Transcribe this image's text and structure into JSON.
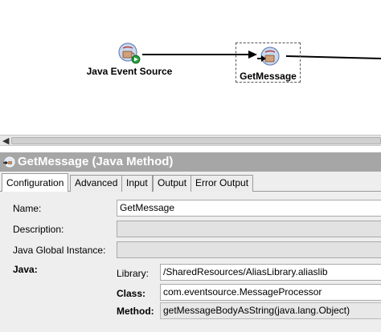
{
  "canvas": {
    "nodes": [
      {
        "label": "Java Event Source",
        "icon": "java-event-source-icon"
      },
      {
        "label": "GetMessage",
        "icon": "java-method-icon"
      }
    ]
  },
  "panel": {
    "title": "GetMessage (Java Method)",
    "tabs": [
      {
        "label": "Configuration",
        "active": true
      },
      {
        "label": "Advanced"
      },
      {
        "label": "Input"
      },
      {
        "label": "Output"
      },
      {
        "label": "Error Output"
      }
    ]
  },
  "form": {
    "name_label": "Name:",
    "name_value": "GetMessage",
    "description_label": "Description:",
    "description_value": "",
    "jgi_label": "Java Global Instance:",
    "jgi_value": "",
    "java_label": "Java:",
    "library_label": "Library:",
    "library_value": "/SharedResources/AliasLibrary.aliaslib",
    "class_label": "Class:",
    "class_value": "com.eventsource.MessageProcessor",
    "method_label": "Method:",
    "method_value": "getMessageBodyAsString(java.lang.Object)"
  }
}
